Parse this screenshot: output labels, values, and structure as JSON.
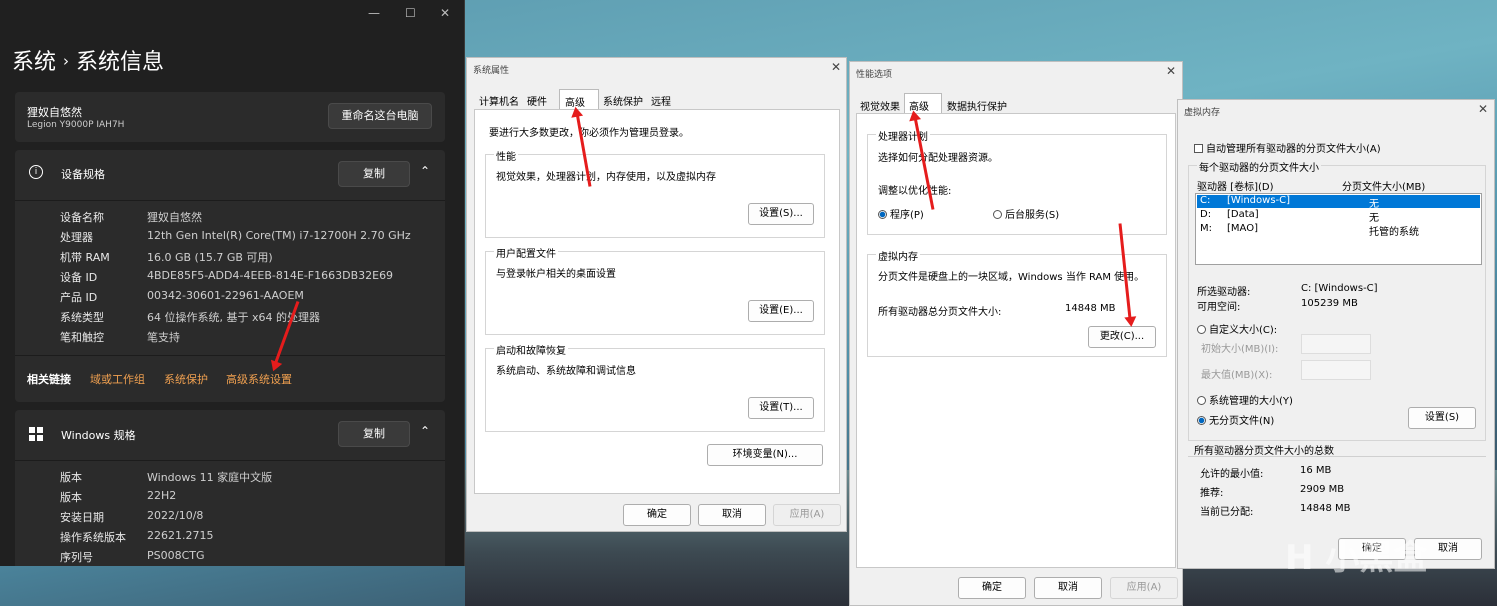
{
  "settings": {
    "crumb_parent": "系统",
    "crumb_sep": "›",
    "crumb_title": "系统信息",
    "device_name": "狸奴自悠然",
    "device_model": "Legion Y9000P IAH7H",
    "rename_btn": "重命名这台电脑",
    "spec_title": "设备规格",
    "copy_label": "复制",
    "specs": [
      {
        "k": "设备名称",
        "v": "狸奴自悠然"
      },
      {
        "k": "处理器",
        "v": "12th Gen Intel(R) Core(TM) i7-12700H   2.70 GHz"
      },
      {
        "k": "机带 RAM",
        "v": "16.0 GB (15.7 GB 可用)"
      },
      {
        "k": "设备 ID",
        "v": "4BDE85F5-ADD4-4EEB-814E-F1663DB32E69"
      },
      {
        "k": "产品 ID",
        "v": "00342-30601-22961-AAOEM"
      },
      {
        "k": "系统类型",
        "v": "64 位操作系统, 基于 x64 的处理器"
      },
      {
        "k": "笔和触控",
        "v": "笔支持"
      }
    ],
    "related": "相关链接",
    "links": [
      "域或工作组",
      "系统保护",
      "高级系统设置"
    ],
    "win_title": "Windows 规格",
    "winspecs": [
      {
        "k": "版本",
        "v": "Windows 11 家庭中文版"
      },
      {
        "k": "版本",
        "v": "22H2"
      },
      {
        "k": "安装日期",
        "v": "2022/10/8"
      },
      {
        "k": "操作系统版本",
        "v": "22621.2715"
      },
      {
        "k": "序列号",
        "v": "PS008CTG"
      }
    ]
  },
  "sysprops": {
    "title": "系统属性",
    "tabs": [
      "计算机名",
      "硬件",
      "高级",
      "系统保护",
      "远程"
    ],
    "admin_note": "要进行大多数更改，你必须作为管理员登录。",
    "perf": "性能",
    "perf_desc": "视觉效果，处理器计划，内存使用，以及虚拟内存",
    "set1": "设置(S)...",
    "profile": "用户配置文件",
    "profile_desc": "与登录帐户相关的桌面设置",
    "set2": "设置(E)...",
    "startup": "启动和故障恢复",
    "startup_desc": "系统启动、系统故障和调试信息",
    "set3": "设置(T)...",
    "env": "环境变量(N)...",
    "ok": "确定",
    "cancel": "取消",
    "apply": "应用(A)"
  },
  "perfopt": {
    "title": "性能选项",
    "tabs": [
      "视觉效果",
      "高级",
      "数据执行保护"
    ],
    "sched": "处理器计划",
    "sched_desc": "选择如何分配处理器资源。",
    "adjust": "调整以优化性能:",
    "r1": "程序(P)",
    "r2": "后台服务(S)",
    "vm": "虚拟内存",
    "vm_desc": "分页文件是硬盘上的一块区域，Windows 当作 RAM 使用。",
    "vm_total_label": "所有驱动器总分页文件大小:",
    "vm_total": "14848 MB",
    "change": "更改(C)...",
    "ok": "确定",
    "cancel": "取消",
    "apply": "应用(A)"
  },
  "vmem": {
    "title": "虚拟内存",
    "auto": "自动管理所有驱动器的分页文件大小(A)",
    "each": "每个驱动器的分页文件大小",
    "col1": "驱动器 [卷标](D)",
    "col2": "分页文件大小(MB)",
    "drives": [
      {
        "d": "C:",
        "l": "[Windows-C]",
        "s": "无"
      },
      {
        "d": "D:",
        "l": "[Data]",
        "s": "无"
      },
      {
        "d": "M:",
        "l": "[MAO]",
        "s": "托管的系统"
      }
    ],
    "sel_label": "所选驱动器:",
    "sel": "C:  [Windows-C]",
    "free_label": "可用空间:",
    "free": "105239 MB",
    "custom": "自定义大小(C):",
    "init": "初始大小(MB)(I):",
    "max": "最大值(MB)(X):",
    "sysman": "系统管理的大小(Y)",
    "nopage": "无分页文件(N)",
    "set": "设置(S)",
    "total": "所有驱动器分页文件大小的总数",
    "min_label": "允许的最小值:",
    "min": "16 MB",
    "rec_label": "推荐:",
    "rec": "2909 MB",
    "cur_label": "当前已分配:",
    "cur": "14848 MB",
    "ok": "确定",
    "cancel": "取消"
  },
  "watermark": "小黑盒"
}
